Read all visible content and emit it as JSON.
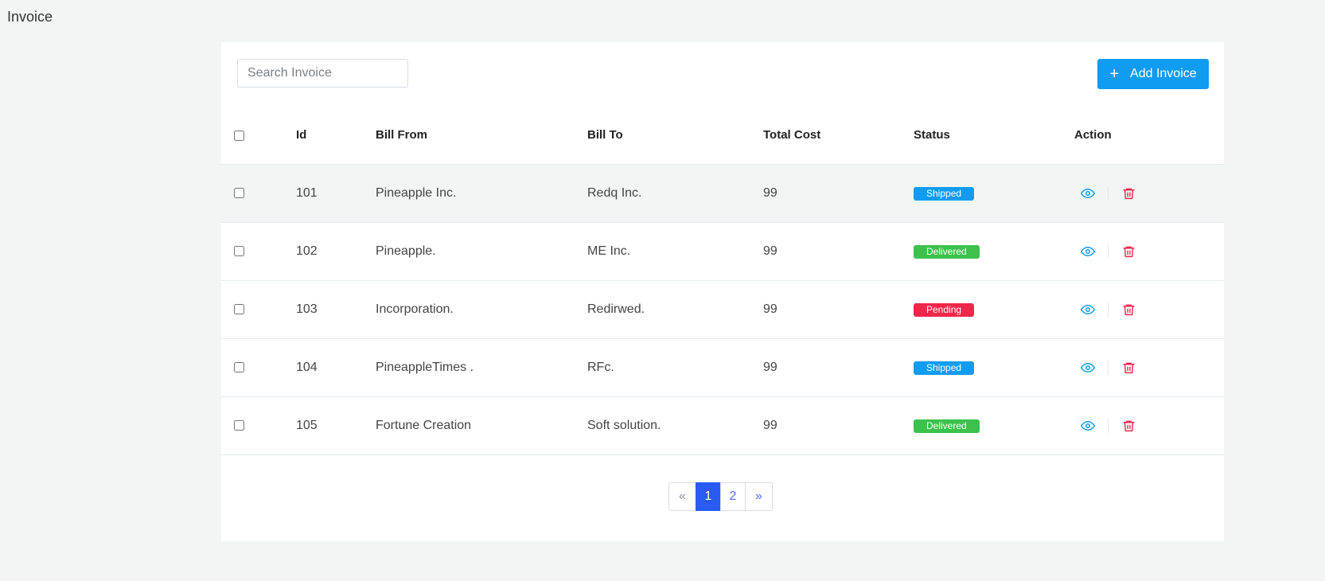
{
  "page": {
    "title": "Invoice"
  },
  "search": {
    "placeholder": "Search Invoice",
    "value": ""
  },
  "add_button": {
    "label": "Add Invoice",
    "icon": "plus-icon"
  },
  "table": {
    "headers": [
      "Id",
      "Bill From",
      "Bill To",
      "Total Cost",
      "Status",
      "Action"
    ],
    "rows": [
      {
        "id": "101",
        "bill_from": "Pineapple Inc.",
        "bill_to": "Redq Inc.",
        "total_cost": "99",
        "status": "Shipped"
      },
      {
        "id": "102",
        "bill_from": "Pineapple.",
        "bill_to": "ME Inc.",
        "total_cost": "99",
        "status": "Delivered"
      },
      {
        "id": "103",
        "bill_from": "Incorporation.",
        "bill_to": "Redirwed.",
        "total_cost": "99",
        "status": "Pending"
      },
      {
        "id": "104",
        "bill_from": "PineappleTimes .",
        "bill_to": "RFc.",
        "total_cost": "99",
        "status": "Shipped"
      },
      {
        "id": "105",
        "bill_from": "Fortune Creation",
        "bill_to": "Soft solution.",
        "total_cost": "99",
        "status": "Delivered"
      }
    ]
  },
  "status_colors": {
    "Shipped": "#109cf1",
    "Delivered": "#3cc14d",
    "Pending": "#f0274a"
  },
  "actions": {
    "view_icon": "eye-icon",
    "delete_icon": "trash-icon",
    "view_color": "#109cf1",
    "delete_color": "#f0274a"
  },
  "pagination": {
    "prev": "«",
    "pages": [
      "1",
      "2"
    ],
    "current": "1",
    "next": "»"
  }
}
